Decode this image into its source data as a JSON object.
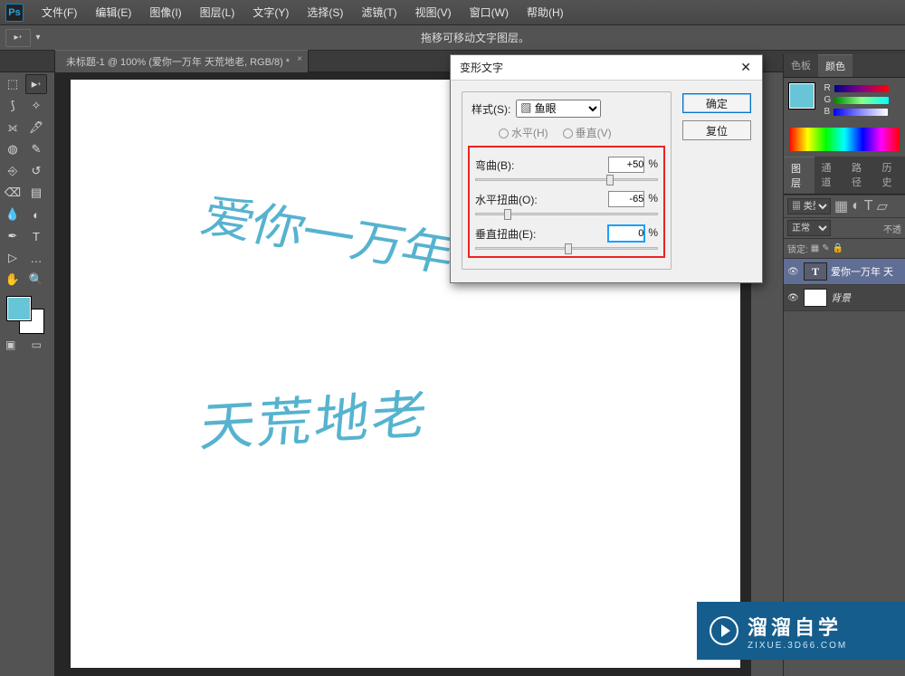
{
  "menubar": {
    "logo": "Ps",
    "items": [
      "文件(F)",
      "编辑(E)",
      "图像(I)",
      "图层(L)",
      "文字(Y)",
      "选择(S)",
      "滤镜(T)",
      "视图(V)",
      "窗口(W)",
      "帮助(H)"
    ]
  },
  "optionsbar": {
    "hint": "拖移可移动文字图层。"
  },
  "doctab": {
    "title": "未标题-1 @ 100% (爱你一万年 天荒地老, RGB/8) *",
    "close": "×"
  },
  "canvas": {
    "line1": "爱你一万年",
    "line2": "天荒地老"
  },
  "tools": {
    "list": [
      "□",
      "▱",
      "⬚",
      "✎",
      "⬛",
      "✦",
      "⌖",
      "⟐",
      "✄",
      "⤢",
      "✎",
      "T",
      "▷",
      "…",
      "✋",
      "🔍"
    ],
    "move_label": "▦"
  },
  "dialog": {
    "title": "变形文字",
    "close": "✕",
    "style_label": "样式(S):",
    "style_value": "▨ 鱼眼",
    "orient_h": "水平(H)",
    "orient_v": "垂直(V)",
    "bend_label": "弯曲(B):",
    "bend_value": "+50",
    "hdist_label": "水平扭曲(O):",
    "hdist_value": "-65",
    "vdist_label": "垂直扭曲(E):",
    "vdist_value": "0",
    "pct": "%",
    "ok": "确定",
    "reset": "复位"
  },
  "right": {
    "color_tabs": [
      "色板",
      "颜色"
    ],
    "layer_tabs": [
      "图层",
      "通道",
      "路径",
      "历史"
    ],
    "rgb": {
      "r": "R",
      "g": "G",
      "b": "B"
    },
    "kind": "▦ 类型",
    "blend": "正常",
    "opacity_lbl": "不透",
    "lock_lbl": "锁定:",
    "layer_text": "爱你一万年 天",
    "layer_bg": "背景"
  },
  "watermark": {
    "big": "溜溜自学",
    "small": "ZIXUE.3D66.COM"
  }
}
